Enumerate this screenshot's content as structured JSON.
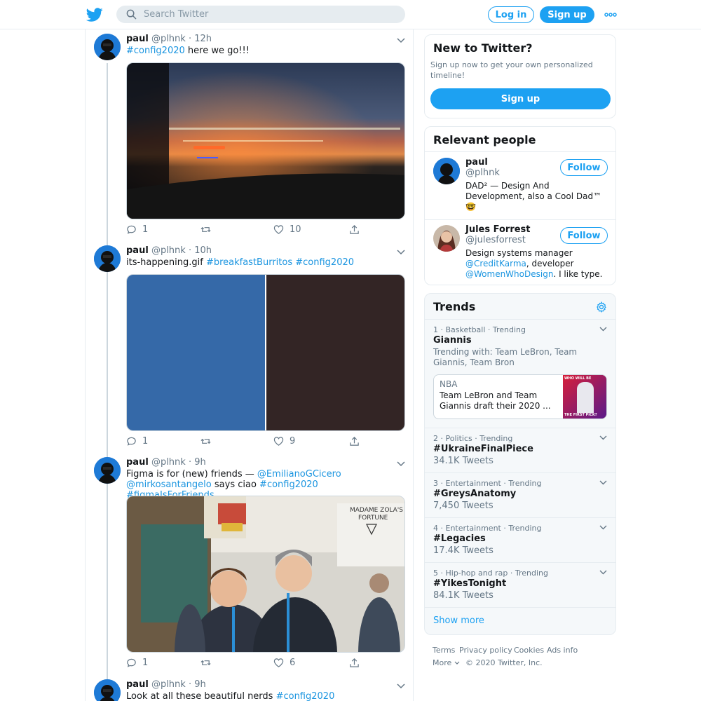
{
  "header": {
    "search_placeholder": "Search Twitter",
    "login_label": "Log in",
    "signup_label": "Sign up",
    "brand_color": "#1da1f2"
  },
  "tweets": [
    {
      "name": "paul",
      "handle": "@plhnk",
      "sep": "·",
      "time": "12h",
      "text_parts": [
        {
          "t": "#config2020",
          "link": true
        },
        {
          "t": " here we go!!!",
          "link": false
        }
      ],
      "replies": "1",
      "retweets": "",
      "likes": "10"
    },
    {
      "name": "paul",
      "handle": "@plhnk",
      "sep": "·",
      "time": "10h",
      "text_parts": [
        {
          "t": "its-happening.gif ",
          "link": false
        },
        {
          "t": "#breakfastBurritos",
          "link": true
        },
        {
          "t": " ",
          "link": false
        },
        {
          "t": "#config2020",
          "link": true
        }
      ],
      "replies": "1",
      "retweets": "",
      "likes": "9"
    },
    {
      "name": "paul",
      "handle": "@plhnk",
      "sep": "·",
      "time": "9h",
      "text_parts": [
        {
          "t": "Figma is for (new) friends — ",
          "link": false
        },
        {
          "t": "@EmilianoGCicero",
          "link": true
        },
        {
          "t": " ",
          "link": false
        },
        {
          "t": "@mirkosantangelo",
          "link": true
        },
        {
          "t": " says ciao ",
          "link": false
        },
        {
          "t": "#config2020",
          "link": true
        },
        {
          "t": " ",
          "link": false
        },
        {
          "t": "#figmaIsForFriends",
          "link": true
        }
      ],
      "replies": "1",
      "retweets": "",
      "likes": "6"
    },
    {
      "name": "paul",
      "handle": "@plhnk",
      "sep": "·",
      "time": "9h",
      "text_parts": [
        {
          "t": "Look at all these beautiful nerds ",
          "link": false
        },
        {
          "t": "#config2020",
          "link": true
        }
      ]
    }
  ],
  "new_to_twitter": {
    "title": "New to Twitter?",
    "body": "Sign up now to get your own personalized timeline!",
    "signup_label": "Sign up"
  },
  "relevant_people": {
    "title": "Relevant people",
    "follow_label": "Follow",
    "people": [
      {
        "name": "paul",
        "handle": "@plhnk",
        "bio": "DAD² — Design And Development, also a Cool Dad™ 🤓"
      },
      {
        "name": "Jules Forrest",
        "handle": "@julesforrest",
        "bio_a": "Design systems manager ",
        "bio_link1": "@CreditKarma",
        "bio_b": ", developer ",
        "bio_link2": "@WomenWhoDesign",
        "bio_c": ". I like type."
      }
    ]
  },
  "trends": {
    "title": "Trends",
    "items": [
      {
        "meta": "1 · Basketball · Trending",
        "name": "Giannis",
        "sub": "Trending with: Team LeBron, Team Giannis, Team Bron",
        "news": {
          "source": "NBA",
          "headline": "Team LeBron and Team Giannis draft their 2020 ...",
          "thumb_top": "WHO WILL BE",
          "thumb_bottom": "THE FIRST PICK?"
        }
      },
      {
        "meta": "2 · Politics · Trending",
        "name": "#UkraineFinalPiece",
        "count": "34.1K Tweets"
      },
      {
        "meta": "3 · Entertainment · Trending",
        "name": "#GreysAnatomy",
        "count": "7,450 Tweets"
      },
      {
        "meta": "4 · Entertainment · Trending",
        "name": "#Legacies",
        "count": "17.4K Tweets"
      },
      {
        "meta": "5 · Hip-hop and rap · Trending",
        "name": "#YikesTonight",
        "count": "84.1K Tweets"
      }
    ],
    "show_more": "Show more"
  },
  "footer": {
    "links": [
      "Terms",
      "Privacy policy",
      "Cookies",
      "Ads info"
    ],
    "more": "More",
    "copyright": "© 2020 Twitter, Inc."
  }
}
